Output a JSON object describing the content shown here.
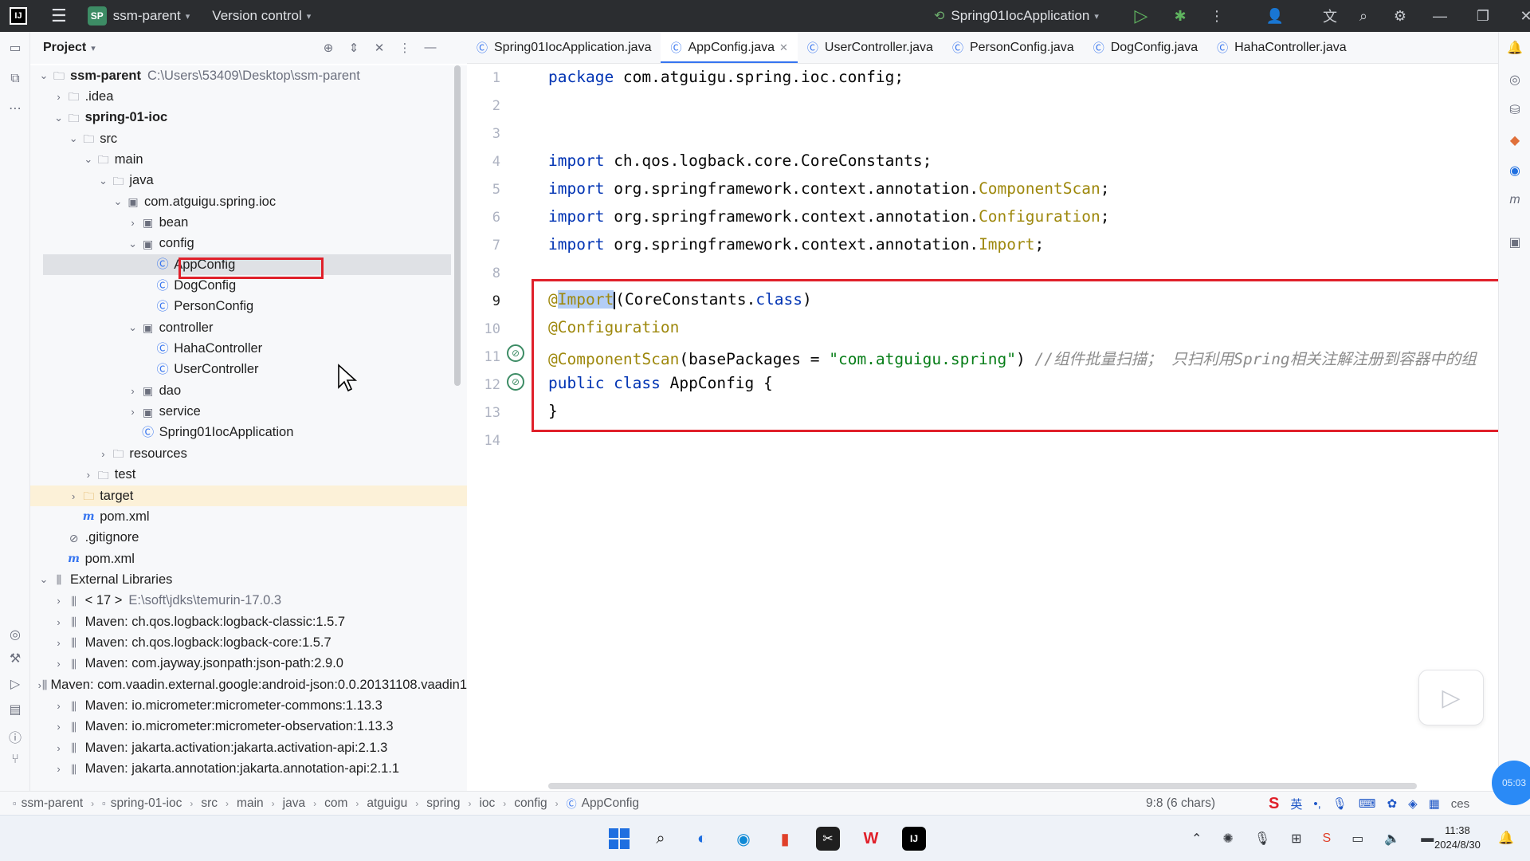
{
  "titlebar": {
    "project_badge": "SP",
    "project_name": "ssm-parent",
    "vcs_label": "Version control",
    "run_config": "Spring01IocApplication"
  },
  "project_panel": {
    "title": "Project",
    "tree": [
      {
        "label": "ssm-parent",
        "path": "C:\\Users\\53409\\Desktop\\ssm-parent",
        "depth": 0,
        "chev": "v",
        "icon": "module-folder",
        "bold": true
      },
      {
        "label": ".idea",
        "depth": 1,
        "chev": ">",
        "icon": "folder"
      },
      {
        "label": "spring-01-ioc",
        "depth": 1,
        "chev": "v",
        "icon": "module-folder",
        "bold": true
      },
      {
        "label": "src",
        "depth": 2,
        "chev": "v",
        "icon": "folder"
      },
      {
        "label": "main",
        "depth": 3,
        "chev": "v",
        "icon": "folder"
      },
      {
        "label": "java",
        "depth": 4,
        "chev": "v",
        "icon": "folder"
      },
      {
        "label": "com.atguigu.spring.ioc",
        "depth": 5,
        "chev": "v",
        "icon": "package"
      },
      {
        "label": "bean",
        "depth": 6,
        "chev": ">",
        "icon": "package"
      },
      {
        "label": "config",
        "depth": 6,
        "chev": "v",
        "icon": "package"
      },
      {
        "label": "AppConfig",
        "depth": 7,
        "chev": "",
        "icon": "class",
        "selected": true
      },
      {
        "label": "DogConfig",
        "depth": 7,
        "chev": "",
        "icon": "class"
      },
      {
        "label": "PersonConfig",
        "depth": 7,
        "chev": "",
        "icon": "class"
      },
      {
        "label": "controller",
        "depth": 6,
        "chev": "v",
        "icon": "package"
      },
      {
        "label": "HahaController",
        "depth": 7,
        "chev": "",
        "icon": "class"
      },
      {
        "label": "UserController",
        "depth": 7,
        "chev": "",
        "icon": "class"
      },
      {
        "label": "dao",
        "depth": 6,
        "chev": ">",
        "icon": "package"
      },
      {
        "label": "service",
        "depth": 6,
        "chev": ">",
        "icon": "package"
      },
      {
        "label": "Spring01IocApplication",
        "depth": 6,
        "chev": "",
        "icon": "class"
      },
      {
        "label": "resources",
        "depth": 4,
        "chev": ">",
        "icon": "folder"
      },
      {
        "label": "test",
        "depth": 3,
        "chev": ">",
        "icon": "folder"
      },
      {
        "label": "target",
        "depth": 2,
        "chev": ">",
        "icon": "folder-orange",
        "target": true
      },
      {
        "label": "pom.xml",
        "depth": 2,
        "chev": "",
        "icon": "maven"
      },
      {
        "label": ".gitignore",
        "depth": 1,
        "chev": "",
        "icon": "ignore"
      },
      {
        "label": "pom.xml",
        "depth": 1,
        "chev": "",
        "icon": "maven"
      },
      {
        "label": "External Libraries",
        "depth": 0,
        "chev": "v",
        "icon": "library"
      },
      {
        "label": "< 17 >",
        "path": "E:\\soft\\jdks\\temurin-17.0.3",
        "depth": 1,
        "chev": ">",
        "icon": "library"
      },
      {
        "label": "Maven: ch.qos.logback:logback-classic:1.5.7",
        "depth": 1,
        "chev": ">",
        "icon": "library"
      },
      {
        "label": "Maven: ch.qos.logback:logback-core:1.5.7",
        "depth": 1,
        "chev": ">",
        "icon": "library"
      },
      {
        "label": "Maven: com.jayway.jsonpath:json-path:2.9.0",
        "depth": 1,
        "chev": ">",
        "icon": "library"
      },
      {
        "label": "Maven: com.vaadin.external.google:android-json:0.0.20131108.vaadin1",
        "depth": 1,
        "chev": ">",
        "icon": "library"
      },
      {
        "label": "Maven: io.micrometer:micrometer-commons:1.13.3",
        "depth": 1,
        "chev": ">",
        "icon": "library"
      },
      {
        "label": "Maven: io.micrometer:micrometer-observation:1.13.3",
        "depth": 1,
        "chev": ">",
        "icon": "library"
      },
      {
        "label": "Maven: jakarta.activation:jakarta.activation-api:2.1.3",
        "depth": 1,
        "chev": ">",
        "icon": "library"
      },
      {
        "label": "Maven: jakarta.annotation:jakarta.annotation-api:2.1.1",
        "depth": 1,
        "chev": ">",
        "icon": "library"
      }
    ]
  },
  "tabs": [
    {
      "label": "Spring01IocApplication.java",
      "active": false
    },
    {
      "label": "AppConfig.java",
      "active": true
    },
    {
      "label": "UserController.java",
      "active": false
    },
    {
      "label": "PersonConfig.java",
      "active": false
    },
    {
      "label": "DogConfig.java",
      "active": false
    },
    {
      "label": "HahaController.java",
      "active": false
    }
  ],
  "editor": {
    "line_numbers": [
      "1",
      "2",
      "3",
      "4",
      "5",
      "6",
      "7",
      "8",
      "9",
      "10",
      "11",
      "12",
      "13",
      "14"
    ],
    "current_line": "9",
    "code": {
      "l1_kw": "package",
      "l1_rest": " com.atguigu.spring.ioc.config;",
      "import_kw": "import",
      "l4_rest": " ch.qos.logback.core.CoreConstants;",
      "l5_pre": " org.springframework.context.annotation.",
      "l5_ann": "ComponentScan",
      "l6_ann": "Configuration",
      "l7_ann": "Import",
      "semi": ";",
      "l9_at": "@",
      "l9_hl": "Import",
      "l9_rest": "(CoreConstants.",
      "l9_class": "class",
      "l9_close": ")",
      "l10": "@Configuration",
      "l11_ann": "@ComponentScan",
      "l11_mid": "(basePackages = ",
      "l11_str": "\"com.atguigu.spring\"",
      "l11_close": ") ",
      "l11_cmt": "//组件批量扫描； 只扫利用Spring相关注解注册到容器中的组",
      "l12_kw": "public class",
      "l12_rest": " AppConfig {",
      "l13": "}"
    }
  },
  "statusbar": {
    "breadcrumbs": [
      "ssm-parent",
      "spring-01-ioc",
      "src",
      "main",
      "java",
      "com",
      "atguigu",
      "spring",
      "ioc",
      "config",
      "AppConfig"
    ],
    "position": "9:8 (6 chars)",
    "ime_lang": "英",
    "ime_tail": "ces"
  },
  "taskbar": {
    "time": "11:38",
    "date": "2024/8/30"
  },
  "overlay": {
    "timestamp": "05:03"
  },
  "colors": {
    "highlight_box": "#e0202a",
    "accent": "#3574f0",
    "keyword": "#0033b3",
    "annotation": "#9e880d",
    "string": "#067d17"
  }
}
